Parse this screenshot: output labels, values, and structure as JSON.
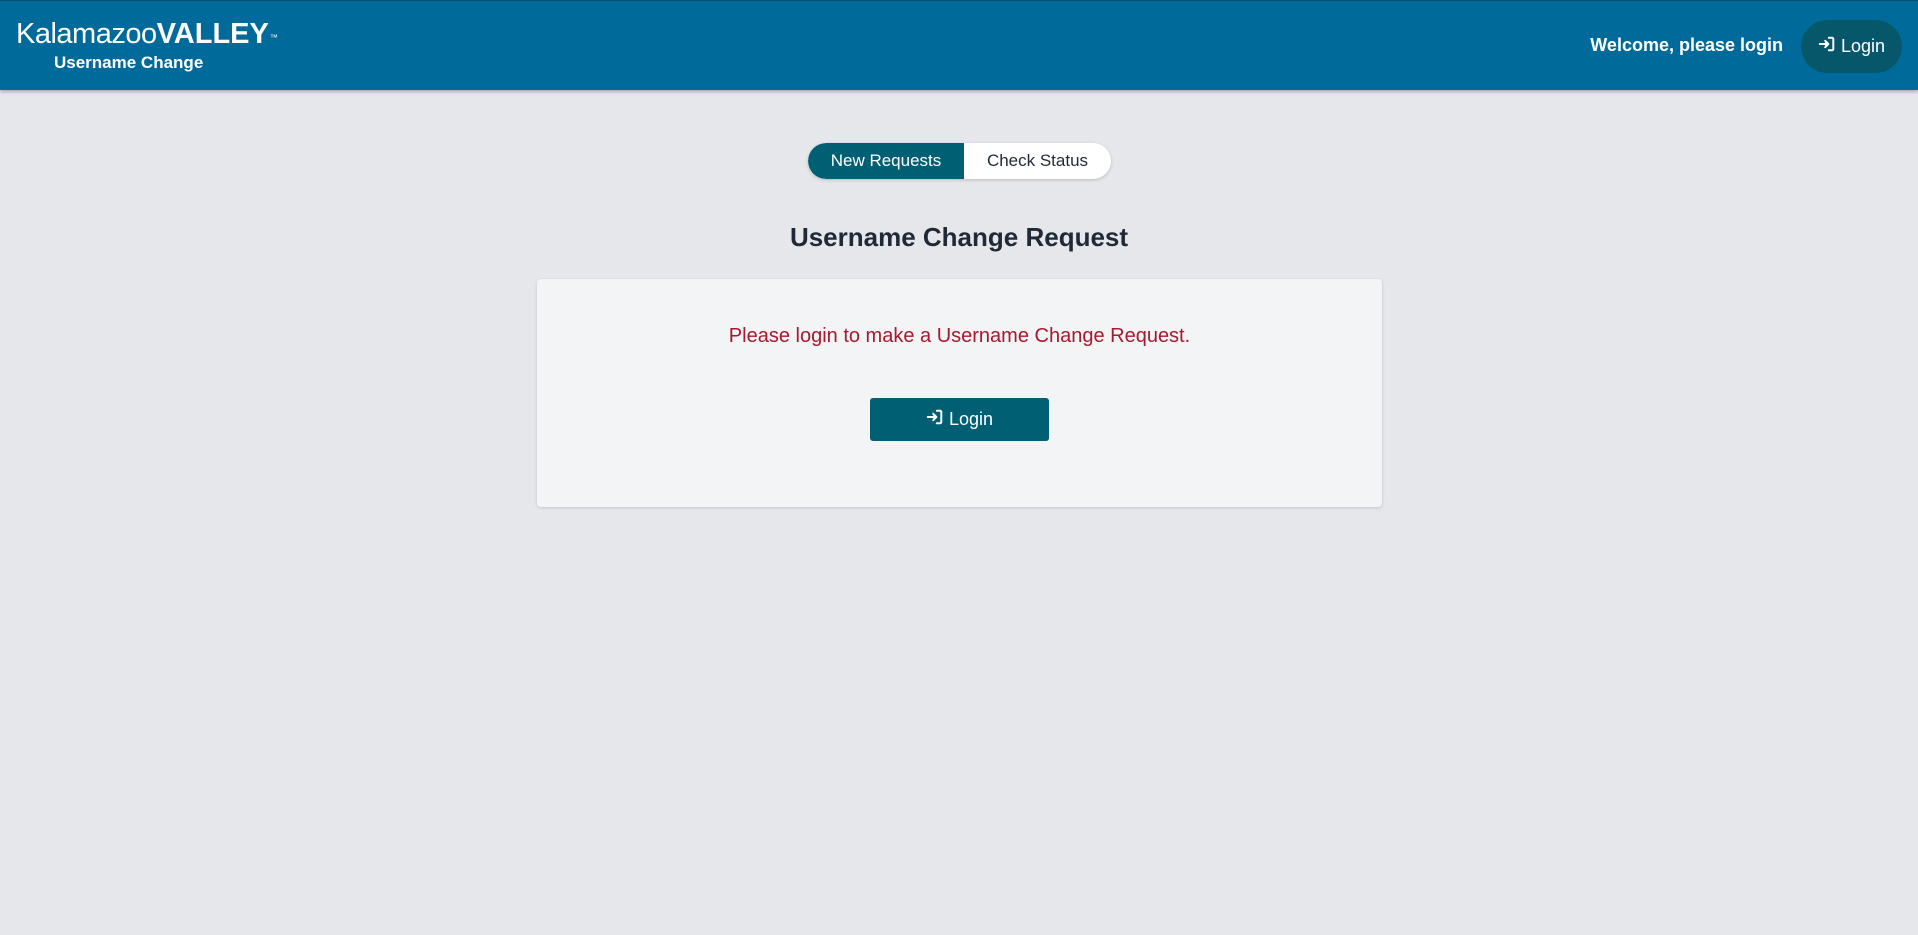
{
  "header": {
    "logo_light": "Kalamazoo",
    "logo_bold": "VALLEY",
    "logo_tm": "™",
    "subtitle": "Username Change",
    "welcome_text": "Welcome, please login",
    "login_label": "Login",
    "login_icon": "sign-in-icon"
  },
  "tabs": [
    {
      "label": "New Requests",
      "active": true
    },
    {
      "label": "Check Status",
      "active": false
    }
  ],
  "main": {
    "title": "Username Change Request",
    "message": "Please login to make a Username Change Request.",
    "login_label": "Login",
    "login_icon": "sign-in-icon"
  },
  "colors": {
    "header_bg": "#006b9a",
    "accent": "#005f73",
    "page_bg": "#e6e7eb",
    "error_text": "#a6192e"
  }
}
